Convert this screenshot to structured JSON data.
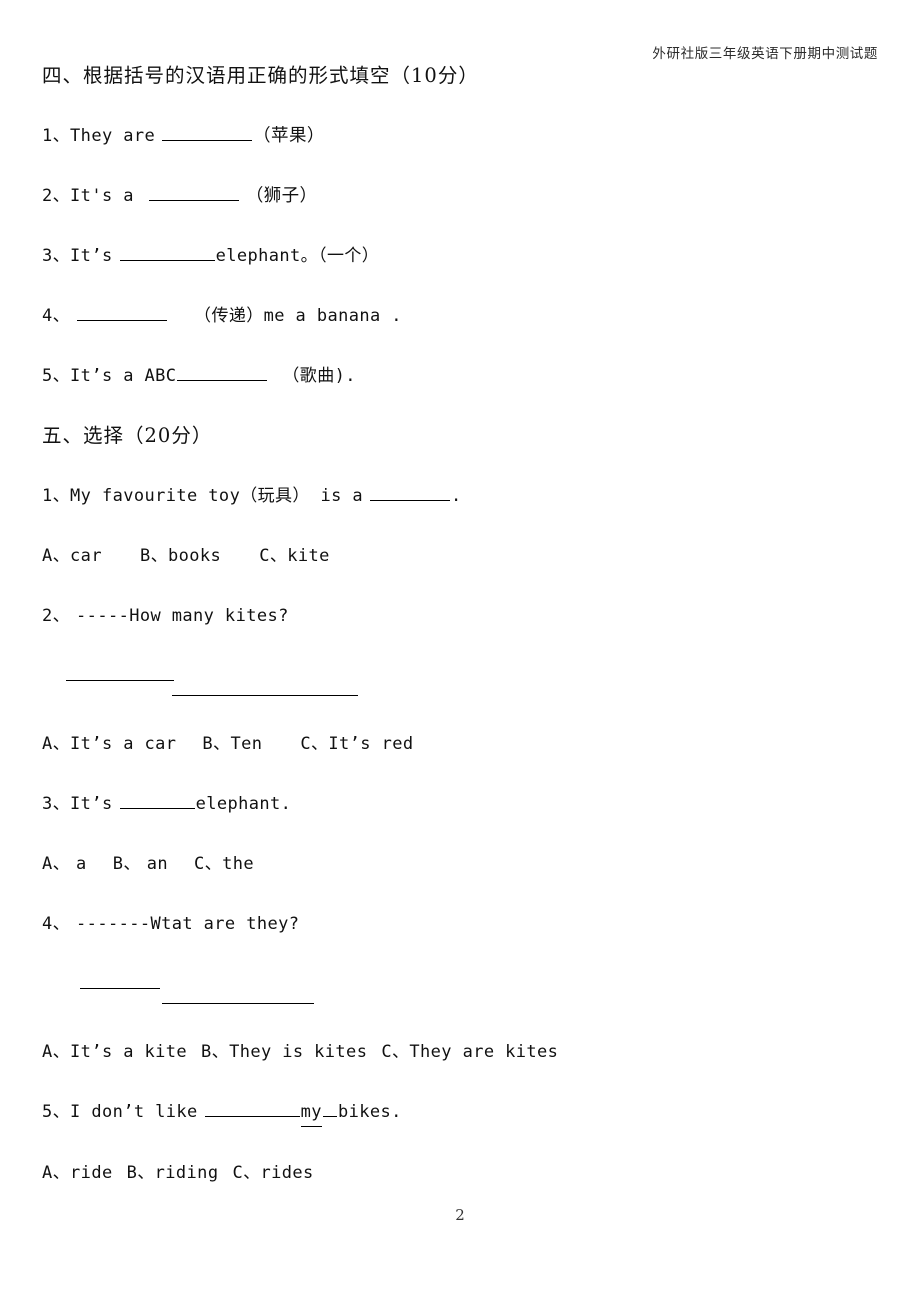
{
  "document": {
    "header_title": "外研社版三年级英语下册期中测试题",
    "page_number": "2"
  },
  "section_four": {
    "heading": "四、根据括号的汉语用正确的形式填空（10分）",
    "questions": [
      {
        "number": "1、",
        "before_blank": "They are",
        "after_blank": "（苹果）"
      },
      {
        "number": "2、",
        "before_blank": "It's a",
        "after_blank": "（狮子）"
      },
      {
        "number": "3、",
        "before_blank": "It’s",
        "after_blank": "elephant。（一个）"
      },
      {
        "number": "4、",
        "before_blank": "",
        "after_blank": "（传递）me a banana ."
      },
      {
        "number": "5、",
        "before_blank": "It’s a ABC",
        "after_blank": "（歌曲)."
      }
    ]
  },
  "section_five": {
    "heading": "五、选择（20分）",
    "questions": [
      {
        "number": "1、",
        "stem_before": "My favourite toy（玩具） is a",
        "stem_after": ".",
        "has_answer_rules": false,
        "options": [
          {
            "letter": "A、",
            "text": "car"
          },
          {
            "letter": "B、",
            "text": "books"
          },
          {
            "letter": "C、",
            "text": "kite"
          }
        ]
      },
      {
        "number": "2、",
        "stem_before": "-----How many kites?",
        "stem_after": "",
        "has_answer_rules": true,
        "options": [
          {
            "letter": "A、",
            "text": "It’s a car"
          },
          {
            "letter": "B、",
            "text": "Ten"
          },
          {
            "letter": "C、",
            "text": "It’s red"
          }
        ]
      },
      {
        "number": "3、",
        "stem_before": "It’s",
        "stem_after": "elephant.",
        "has_answer_rules": false,
        "options": [
          {
            "letter": "A、",
            "text": "a"
          },
          {
            "letter": "B、",
            "text": "an"
          },
          {
            "letter": "C、",
            "text": "the"
          }
        ]
      },
      {
        "number": "4、",
        "stem_before": "-------Wtat are they?",
        "stem_after": "",
        "has_answer_rules": true,
        "options": [
          {
            "letter": "A、",
            "text": "It’s a kite"
          },
          {
            "letter": "B、",
            "text": "They is kites"
          },
          {
            "letter": "C、",
            "text": "They are kites"
          }
        ]
      },
      {
        "number": "5、",
        "stem_before": "I don’t like",
        "stem_underlined": "my",
        "stem_after": "bikes.",
        "has_answer_rules": false,
        "options": [
          {
            "letter": "A、",
            "text": "ride"
          },
          {
            "letter": "B、",
            "text": "riding"
          },
          {
            "letter": "C、",
            "text": "rides"
          }
        ]
      }
    ]
  }
}
